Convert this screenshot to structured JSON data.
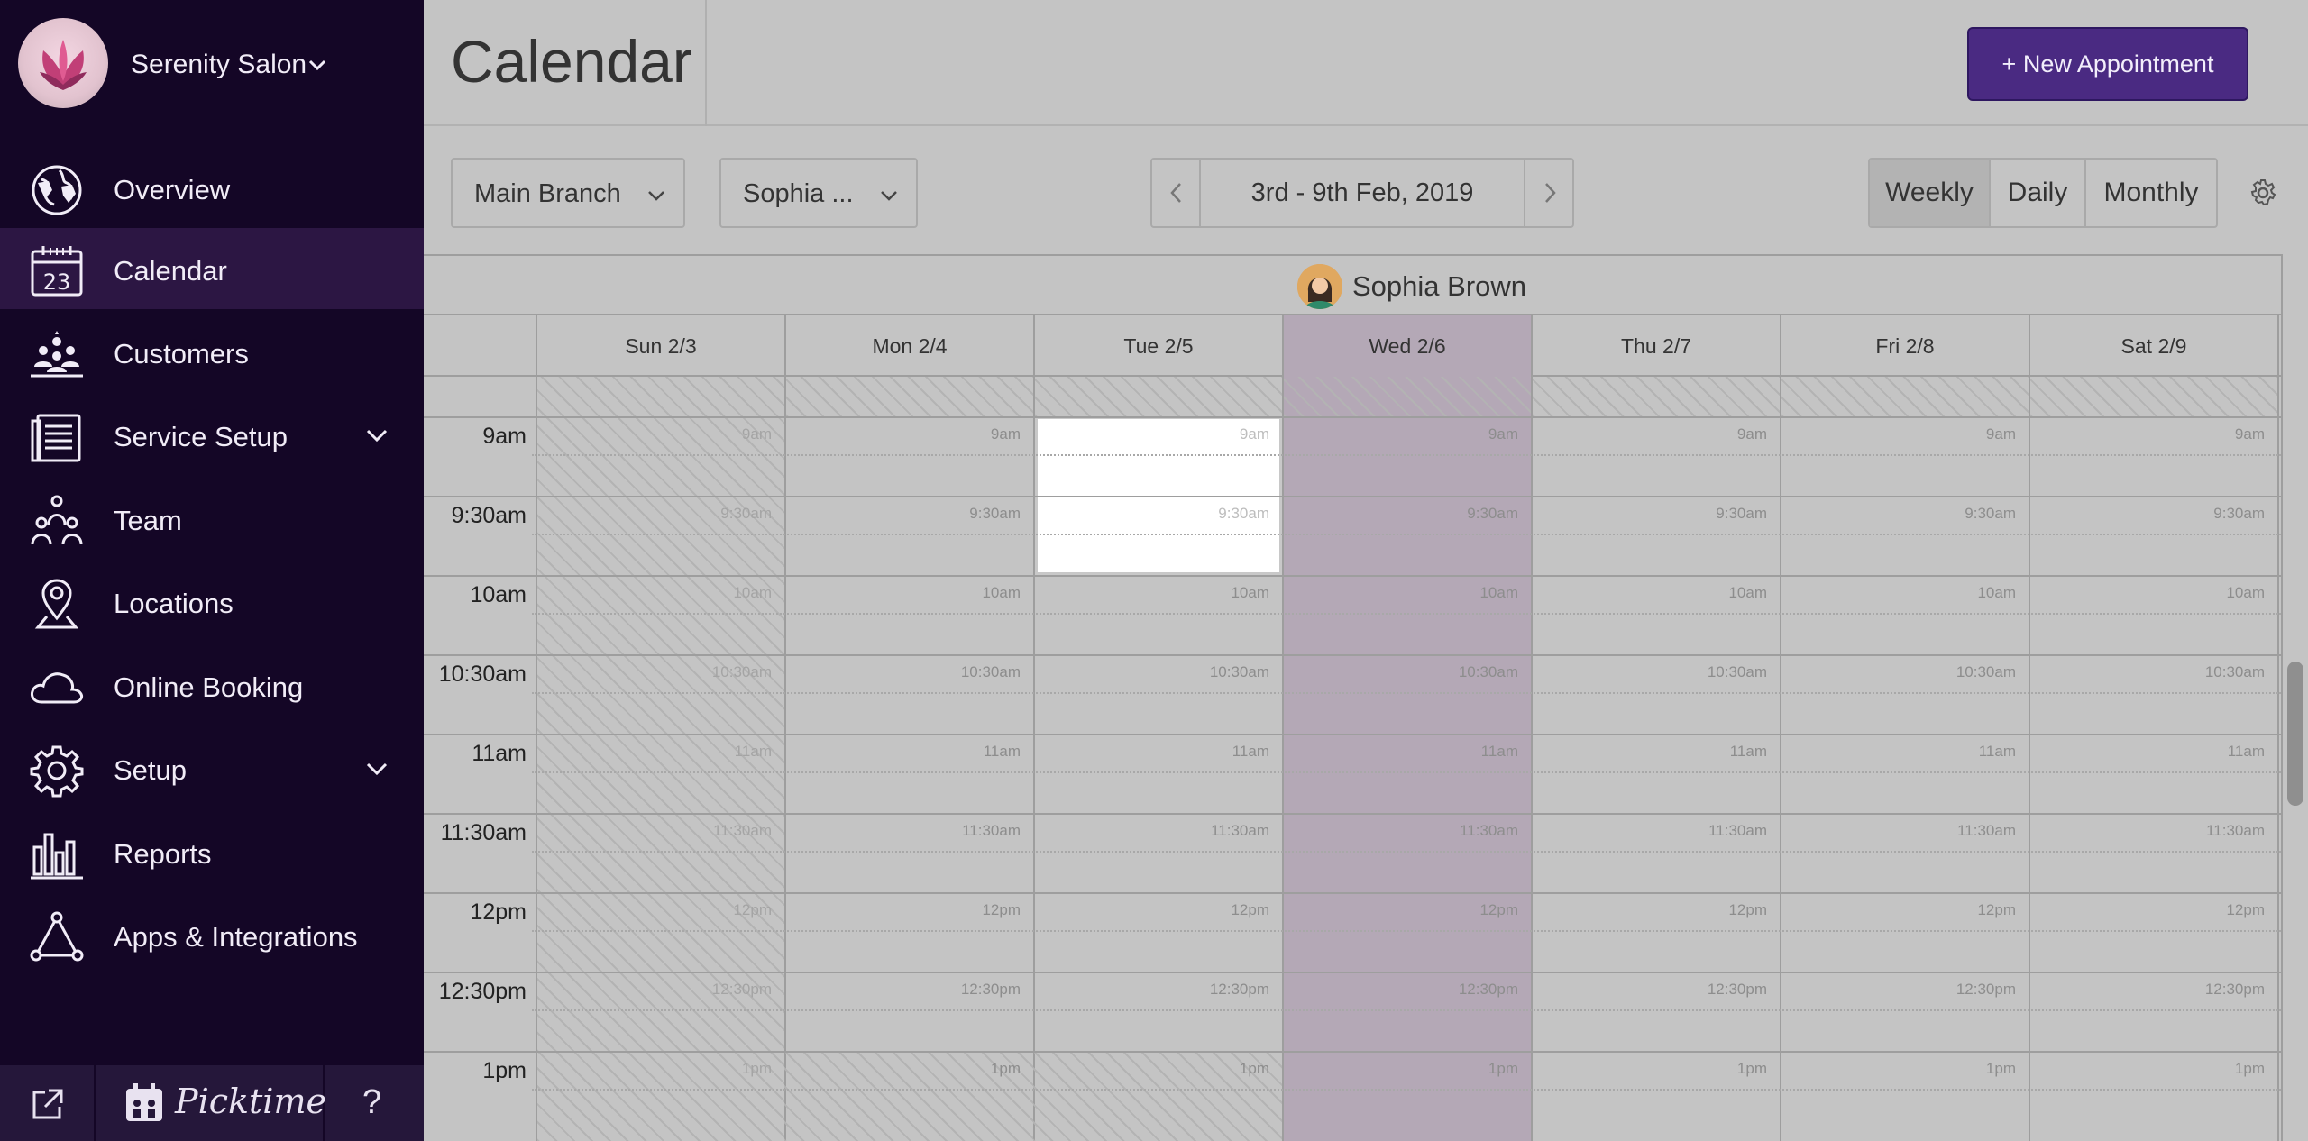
{
  "brand": {
    "name": "Serenity Salon"
  },
  "sidebar": {
    "items": [
      {
        "label": "Overview",
        "icon": "globe-icon",
        "active": false
      },
      {
        "label": "Calendar",
        "icon": "calendar-icon",
        "active": true,
        "calendar_icon_text": "23"
      },
      {
        "label": "Customers",
        "icon": "customers-icon",
        "active": false
      },
      {
        "label": "Service Setup",
        "icon": "service-list-icon",
        "active": false,
        "expandable": true
      },
      {
        "label": "Team",
        "icon": "team-icon",
        "active": false
      },
      {
        "label": "Locations",
        "icon": "location-pin-icon",
        "active": false
      },
      {
        "label": "Online Booking",
        "icon": "cloud-icon",
        "active": false
      },
      {
        "label": "Setup",
        "icon": "gear-icon",
        "active": false,
        "expandable": true
      },
      {
        "label": "Reports",
        "icon": "bar-chart-icon",
        "active": false
      },
      {
        "label": "Apps & Integrations",
        "icon": "integrations-icon",
        "active": false
      }
    ],
    "footer": {
      "brand": "Picktime",
      "help": "?",
      "external_icon": "external-link-icon"
    }
  },
  "header": {
    "title": "Calendar",
    "new_appointment": "+ New Appointment"
  },
  "toolbar": {
    "branch": "Main Branch",
    "staff": "Sophia ...",
    "date_range": "3rd - 9th Feb, 2019",
    "views": [
      {
        "label": "Weekly",
        "active": true
      },
      {
        "label": "Daily",
        "active": false
      },
      {
        "label": "Monthly",
        "active": false
      }
    ]
  },
  "calendar": {
    "staff_name": "Sophia Brown",
    "days": [
      "Sun 2/3",
      "Mon 2/4",
      "Tue 2/5",
      "Wed 2/6",
      "Thu 2/7",
      "Fri 2/8",
      "Sat 2/9"
    ],
    "today_index": 3,
    "times": [
      "9am",
      "9:30am",
      "10am",
      "10:30am",
      "11am",
      "11:30am",
      "12pm",
      "12:30pm",
      "1pm"
    ]
  },
  "colors": {
    "sidebar_bg": "#140626",
    "accent": "#4a2a82",
    "active_nav": "#2c1643"
  }
}
